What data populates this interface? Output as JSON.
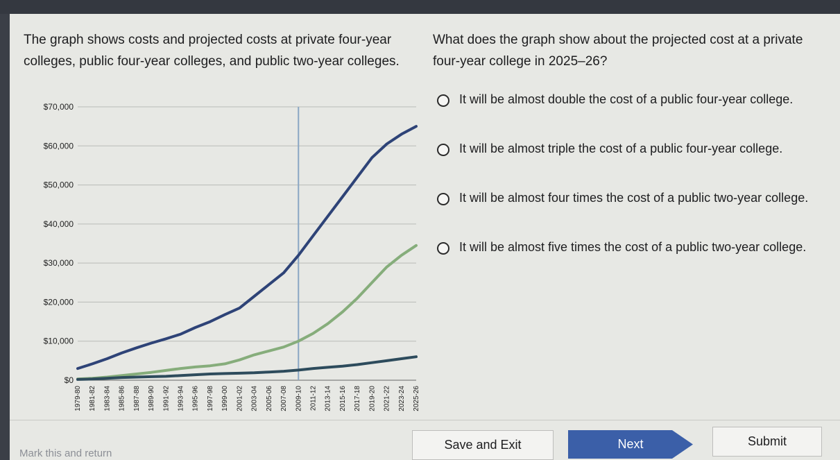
{
  "question": {
    "intro": "The graph shows costs and projected costs at private four-year colleges, public four-year colleges, and public two-year colleges.",
    "prompt": "What does the graph show about the projected cost at a private four-year college in 2025–26?"
  },
  "choices": [
    {
      "label": "It will be almost double the cost of a public four-year college."
    },
    {
      "label": "It will be almost triple the cost of a public four-year college."
    },
    {
      "label": "It will be almost four times the cost of a public two-year college."
    },
    {
      "label": "It will be almost five times the cost of a public two-year college."
    }
  ],
  "footer": {
    "mark_link": "Mark this and return",
    "save_label": "Save and Exit",
    "next_label": "Next",
    "submit_label": "Submit"
  },
  "colors": {
    "private_four_year": "#2e4377",
    "public_four_year": "#86ad7b",
    "public_two_year": "#2d4b5c",
    "reference_line": "#8aa6c4"
  },
  "chart_data": {
    "type": "line",
    "x": [
      "1979-80",
      "1981-82",
      "1983-84",
      "1985-86",
      "1987-88",
      "1989-90",
      "1991-92",
      "1993-94",
      "1995-96",
      "1997-98",
      "1999-00",
      "2001-02",
      "2003-04",
      "2005-06",
      "2007-08",
      "2009-10",
      "2011-12",
      "2013-14",
      "2015-16",
      "2017-18",
      "2019-20",
      "2021-22",
      "2023-24",
      "2025-26"
    ],
    "y_ticks": [
      "$0",
      "$10,000",
      "$20,000",
      "$30,000",
      "$40,000",
      "$50,000",
      "$60,000",
      "$70,000"
    ],
    "ylim": [
      0,
      70000
    ],
    "reference_x": "2009-10",
    "grid": true,
    "series": [
      {
        "values": [
          3000,
          4200,
          5500,
          7000,
          8300,
          9500,
          10600,
          11800,
          13500,
          15000,
          16800,
          18500,
          21500,
          24500,
          27500,
          32000,
          37000,
          42000,
          47000,
          52000,
          57000,
          60500,
          63000,
          65000
        ]
      },
      {
        "values": [
          300,
          500,
          800,
          1200,
          1600,
          2000,
          2500,
          3000,
          3400,
          3700,
          4200,
          5200,
          6500,
          7500,
          8500,
          10000,
          12000,
          14500,
          17500,
          21000,
          25000,
          29000,
          32000,
          34500
        ]
      },
      {
        "values": [
          200,
          300,
          500,
          700,
          800,
          900,
          1000,
          1200,
          1400,
          1600,
          1700,
          1800,
          1900,
          2100,
          2300,
          2600,
          3000,
          3300,
          3600,
          4000,
          4500,
          5000,
          5500,
          6000
        ]
      }
    ]
  }
}
